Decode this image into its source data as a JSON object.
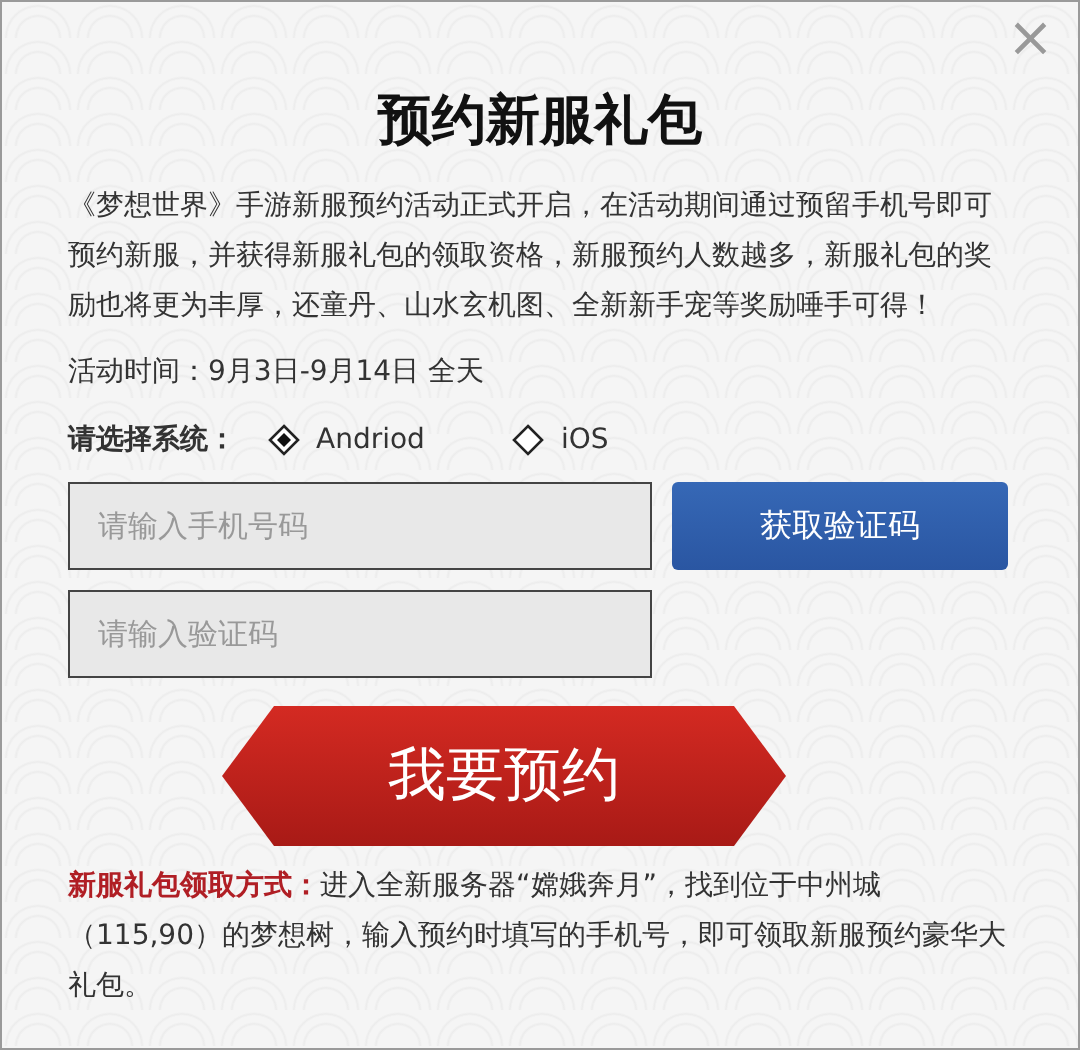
{
  "dialog": {
    "close": "×",
    "title": "预约新服礼包"
  },
  "intro": "《梦想世界》手游新服预约活动正式开启，在活动期间通过预留手机号即可预约新服，并获得新服礼包的领取资格，新服预约人数越多，新服礼包的奖励也将更为丰厚，还童丹、山水玄机图、全新新手宠等奖励唾手可得！",
  "event_time": "活动时间：9月3日-9月14日 全天",
  "system": {
    "label": "请选择系统：",
    "options": [
      {
        "label": "Andriod",
        "selected": true
      },
      {
        "label": "iOS",
        "selected": false
      }
    ]
  },
  "phone_field": {
    "placeholder": "请输入手机号码"
  },
  "code_button": "获取验证码",
  "code_field": {
    "placeholder": "请输入验证码"
  },
  "submit_button": "我要预约",
  "claim": {
    "label": "新服礼包领取方式：",
    "text": "进入全新服务器“嫦娥奔月”，找到位于中州城（115,90）的梦想树，输入预约时填写的手机号，即可领取新服预约豪华大礼包。"
  }
}
